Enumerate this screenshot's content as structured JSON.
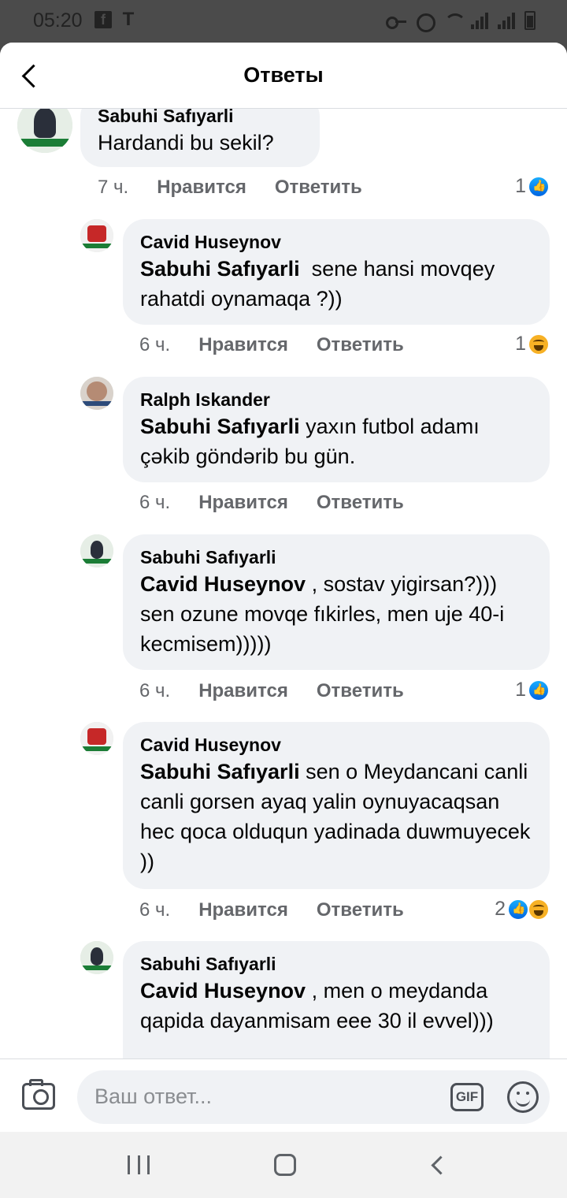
{
  "status_bar": {
    "time": "05:20",
    "left_icons": [
      "facebook-icon",
      "t-icon"
    ],
    "right_icons": [
      "vpn-key-icon",
      "alarm-icon",
      "wifi-icon",
      "signal-icon",
      "signal-icon",
      "battery-icon"
    ]
  },
  "header": {
    "title": "Ответы",
    "back_icon": "chevron-left-icon"
  },
  "comments": [
    {
      "author": "Sabuhi Safıyarli",
      "mention": "",
      "text": "Hardandi bu sekil?",
      "time": "7 ч.",
      "like_label": "Нравится",
      "reply_label": "Ответить",
      "reaction_count": "1",
      "reactions": [
        "like"
      ]
    },
    {
      "author": "Cavid Huseynov",
      "mention": "Sabuhi Safıyarli",
      "text": "  sene hansi movqey rahatdi oynamaqa ?))",
      "time": "6 ч.",
      "like_label": "Нравится",
      "reply_label": "Ответить",
      "reaction_count": "1",
      "reactions": [
        "haha"
      ]
    },
    {
      "author": "Ralph Iskander",
      "mention": "Sabuhi Safıyarli",
      "text": " yaxın futbol adamı çəkib göndərib bu gün.",
      "time": "6 ч.",
      "like_label": "Нравится",
      "reply_label": "Ответить",
      "reaction_count": "",
      "reactions": []
    },
    {
      "author": "Sabuhi Safıyarli",
      "mention": "Cavid Huseynov",
      "text": " , sostav yigirsan?))) sen ozune movqe fıkirles, men uje 40-i kecmisem)))))",
      "time": "6 ч.",
      "like_label": "Нравится",
      "reply_label": "Ответить",
      "reaction_count": "1",
      "reactions": [
        "like"
      ]
    },
    {
      "author": "Cavid Huseynov",
      "mention": "Sabuhi Safıyarli",
      "text": " sen o Meydancani canli canli gorsen ayaq yalin oynuyacaqsan hec qoca olduqun yadinada duwmuyecek ))",
      "time": "6 ч.",
      "like_label": "Нравится",
      "reply_label": "Ответить",
      "reaction_count": "2",
      "reactions": [
        "like",
        "haha"
      ]
    },
    {
      "author": "Sabuhi Safıyarli",
      "mention": "Cavid Huseynov",
      "text": " , men o meydanda qapida dayanmisam eee 30 il evvel)))",
      "time": "",
      "like_label": "",
      "reply_label": "",
      "reaction_count": "",
      "reactions": []
    }
  ],
  "composer": {
    "placeholder": "Ваш ответ...",
    "gif_label": "GIF",
    "camera_icon": "camera-icon",
    "emoji_icon": "emoji-icon"
  },
  "nav_bar": {
    "icons": [
      "recents-icon",
      "home-icon",
      "back-icon"
    ]
  }
}
